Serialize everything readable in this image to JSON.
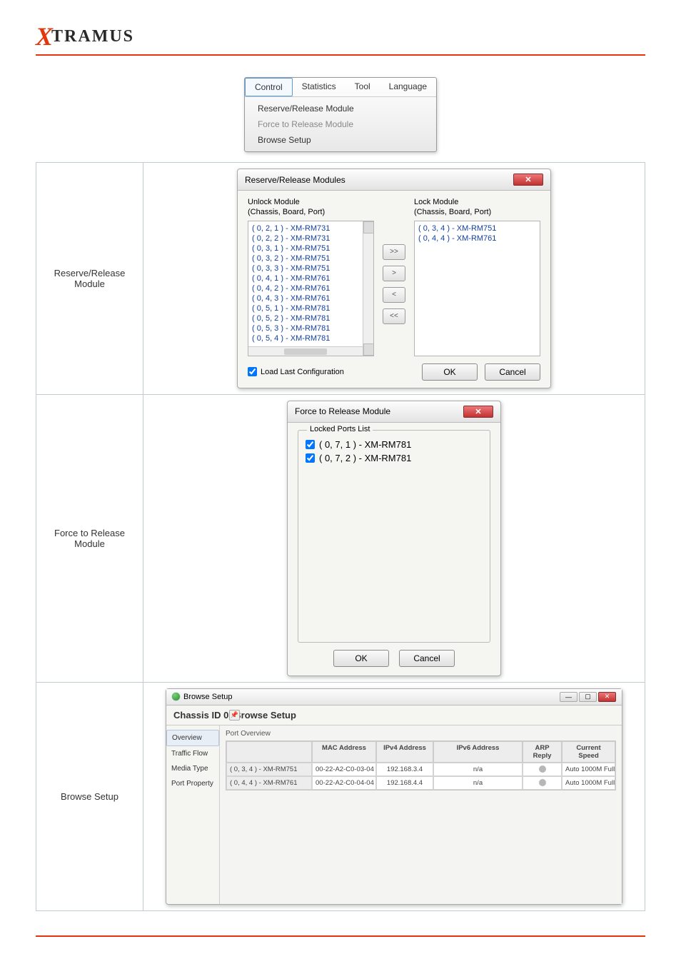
{
  "logo": {
    "prefix": "X",
    "rest": "TRAMUS"
  },
  "menu": {
    "tabs": [
      "Control",
      "Statistics",
      "Tool",
      "Language"
    ],
    "items": [
      "Reserve/Release Module",
      "Force to Release Module",
      "Browse Setup"
    ]
  },
  "rows": {
    "r1_label": "Reserve/Release Module",
    "r2_label": "Force to Release Module",
    "r3_label": "Browse Setup"
  },
  "reserve": {
    "title": "Reserve/Release Modules",
    "unlock_label": "Unlock Module\n(Chassis, Board, Port)",
    "lock_label": "Lock Module\n(Chassis, Board, Port)",
    "unlock_list": [
      "( 0, 2, 1 ) - XM-RM731",
      "( 0, 2, 2 ) - XM-RM731",
      "( 0, 3, 1 ) - XM-RM751",
      "( 0, 3, 2 ) - XM-RM751",
      "( 0, 3, 3 ) - XM-RM751",
      "( 0, 4, 1 ) - XM-RM761",
      "( 0, 4, 2 ) - XM-RM761",
      "( 0, 4, 3 ) - XM-RM761",
      "( 0, 5, 1 ) - XM-RM781",
      "( 0, 5, 2 ) - XM-RM781",
      "( 0, 5, 3 ) - XM-RM781",
      "( 0, 5, 4 ) - XM-RM781"
    ],
    "lock_list": [
      "( 0, 3, 4 ) - XM-RM751",
      "( 0, 4, 4 ) - XM-RM761"
    ],
    "btns": {
      "all_r": ">>",
      "one_r": ">",
      "one_l": "<",
      "all_l": "<<"
    },
    "load_last_label": "Load Last Configuration",
    "ok": "OK",
    "cancel": "Cancel"
  },
  "force": {
    "title": "Force to Release Module",
    "list_label": "Locked Ports List",
    "items": [
      "( 0, 7, 1 ) - XM-RM781",
      "( 0, 7, 2 ) - XM-RM781"
    ],
    "ok": "OK",
    "cancel": "Cancel"
  },
  "browse": {
    "win_title": "Browse Setup",
    "subtitle": "Chassis ID 0: Browse Setup",
    "side": [
      "Overview",
      "Traffic Flow",
      "Media Type",
      "Port Property"
    ],
    "pane_label": "Port Overview",
    "cols": [
      "",
      "MAC Address",
      "IPv4 Address",
      "IPv6 Address",
      "ARP Reply",
      "Current Speed"
    ],
    "grid": [
      {
        "port": "( 0, 3, 4 ) - XM-RM751",
        "mac": "00-22-A2-C0-03-04",
        "ip4": "192.168.3.4",
        "ip6": "n/a",
        "speed": "Auto 1000M Full"
      },
      {
        "port": "( 0, 4, 4 ) - XM-RM761",
        "mac": "00-22-A2-C0-04-04",
        "ip4": "192.168.4.4",
        "ip6": "n/a",
        "speed": "Auto 1000M Full"
      }
    ]
  }
}
